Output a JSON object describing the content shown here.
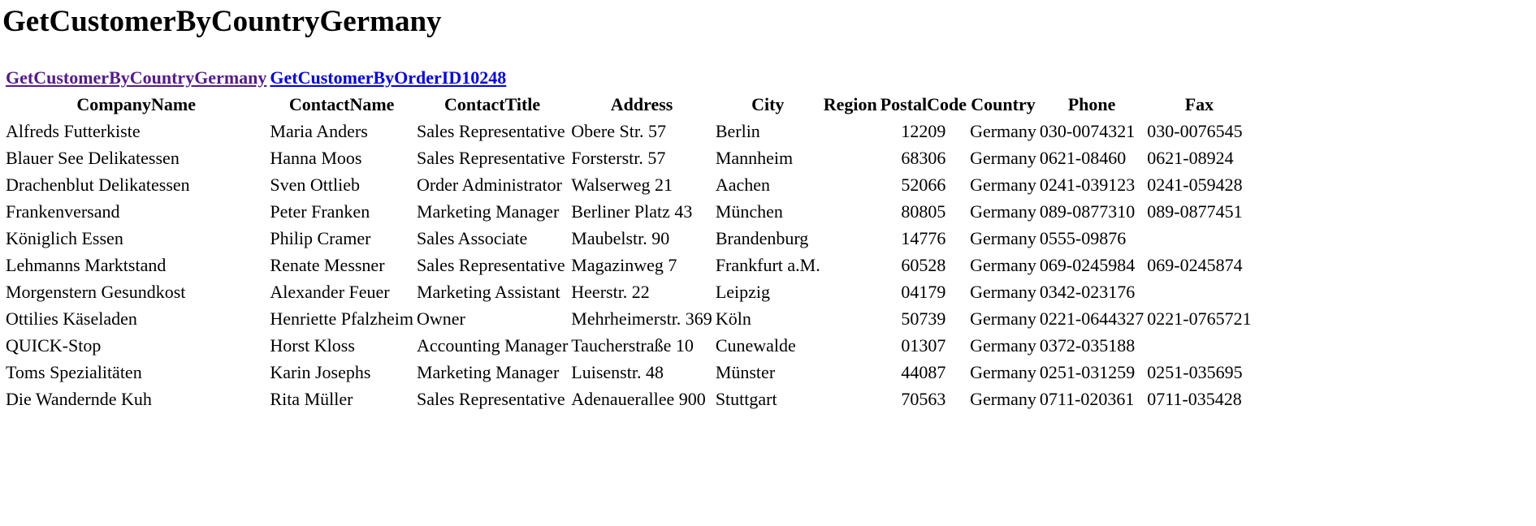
{
  "page": {
    "title": "GetCustomerByCountryGermany"
  },
  "links": [
    {
      "label": "GetCustomerByCountryGermany",
      "color": "#551a8b"
    },
    {
      "label": "GetCustomerByOrderID10248",
      "color": "#0000ee"
    }
  ],
  "table": {
    "headers": [
      "CompanyName",
      "ContactName",
      "ContactTitle",
      "Address",
      "City",
      "Region",
      "PostalCode",
      "Country",
      "Phone",
      "Fax"
    ],
    "rows": [
      [
        "Alfreds Futterkiste",
        "Maria Anders",
        "Sales Representative",
        "Obere Str. 57",
        "Berlin",
        "",
        "12209",
        "Germany",
        "030-0074321",
        "030-0076545"
      ],
      [
        "Blauer See Delikatessen",
        "Hanna Moos",
        "Sales Representative",
        "Forsterstr. 57",
        "Mannheim",
        "",
        "68306",
        "Germany",
        "0621-08460",
        "0621-08924"
      ],
      [
        "Drachenblut Delikatessen",
        "Sven Ottlieb",
        "Order Administrator",
        "Walserweg 21",
        "Aachen",
        "",
        "52066",
        "Germany",
        "0241-039123",
        "0241-059428"
      ],
      [
        "Frankenversand",
        "Peter Franken",
        "Marketing Manager",
        "Berliner Platz 43",
        "München",
        "",
        "80805",
        "Germany",
        "089-0877310",
        "089-0877451"
      ],
      [
        "Königlich Essen",
        "Philip Cramer",
        "Sales Associate",
        "Maubelstr. 90",
        "Brandenburg",
        "",
        "14776",
        "Germany",
        "0555-09876",
        ""
      ],
      [
        "Lehmanns Marktstand",
        "Renate Messner",
        "Sales Representative",
        "Magazinweg 7",
        "Frankfurt a.M.",
        "",
        "60528",
        "Germany",
        "069-0245984",
        "069-0245874"
      ],
      [
        "Morgenstern Gesundkost",
        "Alexander Feuer",
        "Marketing Assistant",
        "Heerstr. 22",
        "Leipzig",
        "",
        "04179",
        "Germany",
        "0342-023176",
        ""
      ],
      [
        "Ottilies Käseladen",
        "Henriette Pfalzheim",
        "Owner",
        "Mehrheimerstr. 369",
        "Köln",
        "",
        "50739",
        "Germany",
        "0221-0644327",
        "0221-0765721"
      ],
      [
        "QUICK-Stop",
        "Horst Kloss",
        "Accounting Manager",
        "Taucherstraße 10",
        "Cunewalde",
        "",
        "01307",
        "Germany",
        "0372-035188",
        ""
      ],
      [
        "Toms Spezialitäten",
        "Karin Josephs",
        "Marketing Manager",
        "Luisenstr. 48",
        "Münster",
        "",
        "44087",
        "Germany",
        "0251-031259",
        "0251-035695"
      ],
      [
        "Die Wandernde Kuh",
        "Rita Müller",
        "Sales Representative",
        "Adenauerallee 900",
        "Stuttgart",
        "",
        "70563",
        "Germany",
        "0711-020361",
        "0711-035428"
      ]
    ]
  }
}
